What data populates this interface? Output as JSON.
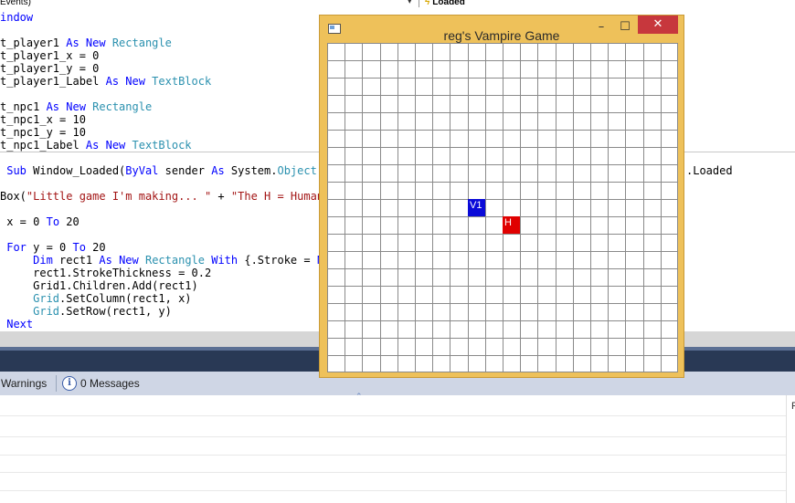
{
  "toolbar": {
    "object_dropdown": "Events)",
    "event_dropdown": "Loaded"
  },
  "code": {
    "lines": [
      {
        "segs": [
          [
            "kw",
            "indow"
          ]
        ]
      },
      {
        "segs": []
      },
      {
        "segs": [
          [
            "",
            "t_player1 "
          ],
          [
            "kw",
            "As New "
          ],
          [
            "ty",
            "Rectangle"
          ]
        ]
      },
      {
        "segs": [
          [
            "",
            "t_player1_x = 0"
          ]
        ]
      },
      {
        "segs": [
          [
            "",
            "t_player1_y = 0"
          ]
        ]
      },
      {
        "segs": [
          [
            "",
            "t_player1_Label "
          ],
          [
            "kw",
            "As New "
          ],
          [
            "ty",
            "TextBlock"
          ]
        ]
      },
      {
        "segs": []
      },
      {
        "segs": [
          [
            "",
            "t_npc1 "
          ],
          [
            "kw",
            "As New "
          ],
          [
            "ty",
            "Rectangle"
          ]
        ]
      },
      {
        "segs": [
          [
            "",
            "t_npc1_x = 10"
          ]
        ]
      },
      {
        "segs": [
          [
            "",
            "t_npc1_y = 10"
          ]
        ]
      },
      {
        "segs": [
          [
            "",
            "t_npc1_Label "
          ],
          [
            "kw",
            "As New "
          ],
          [
            "ty",
            "TextBlock"
          ]
        ]
      }
    ],
    "lines2": [
      {
        "segs": [
          [
            "kw",
            " Sub "
          ],
          [
            "",
            "Window_Loaded("
          ],
          [
            "kw",
            "ByVal "
          ],
          [
            "",
            "sender "
          ],
          [
            "kw",
            "As "
          ],
          [
            "",
            "System."
          ],
          [
            "ty",
            "Object"
          ],
          [
            "",
            ", "
          ]
        ]
      },
      {
        "segs": []
      },
      {
        "segs": [
          [
            "",
            "Box("
          ],
          [
            "st",
            "\"Little game I'm making... \""
          ],
          [
            "",
            " + "
          ],
          [
            "st",
            "\"The H = Human,"
          ]
        ]
      },
      {
        "segs": []
      },
      {
        "segs": [
          [
            "kw",
            " "
          ],
          [
            "",
            ""
          ],
          [
            "",
            "x = 0 "
          ],
          [
            "kw",
            "To "
          ],
          [
            "",
            "20"
          ]
        ]
      },
      {
        "segs": []
      },
      {
        "segs": [
          [
            "kw",
            " For "
          ],
          [
            "",
            "y = 0 "
          ],
          [
            "kw",
            "To "
          ],
          [
            "",
            "20"
          ]
        ]
      },
      {
        "segs": [
          [
            "kw",
            "     Dim "
          ],
          [
            "",
            "rect1 "
          ],
          [
            "kw",
            "As New "
          ],
          [
            "ty",
            "Rectangle "
          ],
          [
            "kw",
            "With "
          ],
          [
            "",
            "{.Stroke = "
          ],
          [
            "kw",
            "Ne"
          ]
        ]
      },
      {
        "segs": [
          [
            "",
            "     rect1.StrokeThickness = 0.2"
          ]
        ]
      },
      {
        "segs": [
          [
            "",
            "     Grid1.Children.Add(rect1)"
          ]
        ]
      },
      {
        "segs": [
          [
            "ty",
            "     Grid"
          ],
          [
            "",
            ".SetColumn(rect1, x)"
          ]
        ]
      },
      {
        "segs": [
          [
            "ty",
            "     Grid"
          ],
          [
            "",
            ".SetRow(rect1, y)"
          ]
        ]
      },
      {
        "segs": [
          [
            "kw",
            " Next"
          ]
        ]
      }
    ],
    "handles_suffix": ".Loaded"
  },
  "error_list": {
    "warnings": "Warnings",
    "messages": "0 Messages",
    "right_header": "F"
  },
  "game_window": {
    "title": "reg's Vampire Game",
    "minimize": "–",
    "maximize": "☐",
    "close": "✕",
    "grid_cols": 20,
    "grid_rows": 19,
    "line_color": "#8a8a8a",
    "npc": {
      "label": "V1",
      "col": 8,
      "row": 9,
      "color": "#0a0ad8"
    },
    "player": {
      "label": "H",
      "col": 10,
      "row": 10,
      "color": "#e00000"
    }
  },
  "colors": {
    "title_bg": "#eec15a",
    "close_bg": "#c7373d"
  }
}
